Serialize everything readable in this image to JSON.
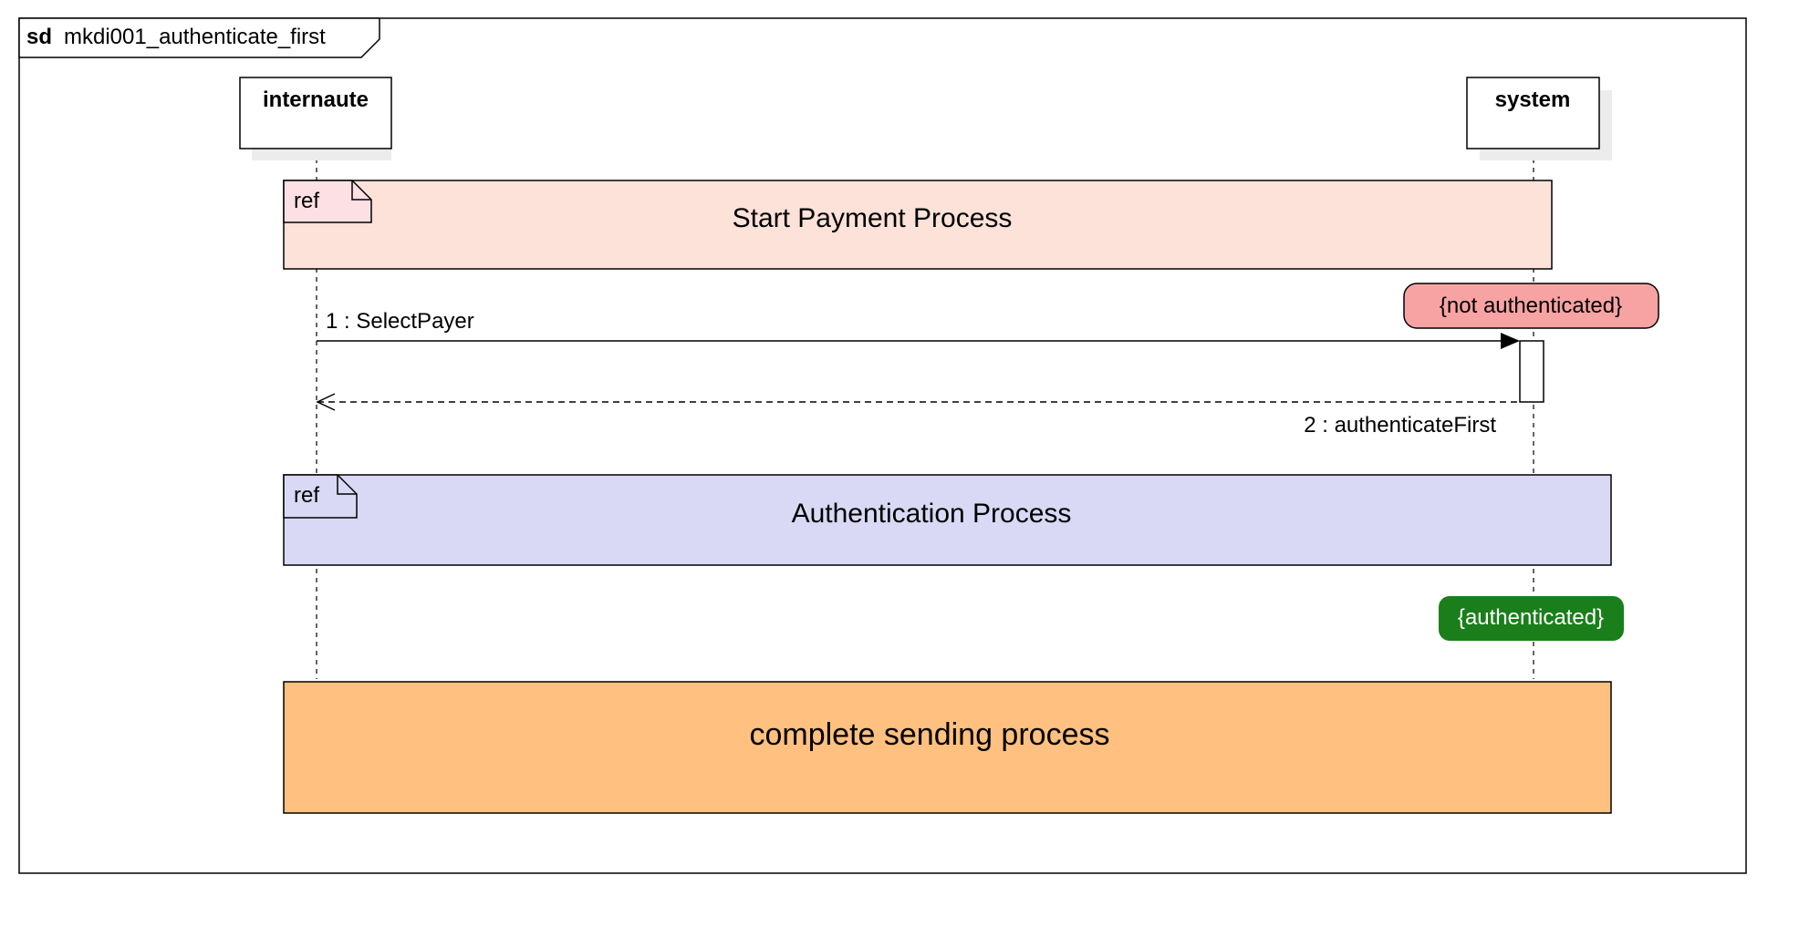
{
  "frame": {
    "keyword": "sd",
    "name": "mkdi001_authenticate_first"
  },
  "lifelines": {
    "left": {
      "label": "internaute"
    },
    "right": {
      "label": "system"
    }
  },
  "fragments": {
    "start_payment": {
      "tag": "ref",
      "label": "Start Payment Process",
      "fill": "#fde2d9"
    },
    "authentication": {
      "tag": "ref",
      "label": "Authentication Process",
      "fill": "#d9d9f5"
    },
    "complete_sending": {
      "label": "complete sending process",
      "fill": "#ffc080"
    }
  },
  "messages": {
    "select_payer": {
      "label": "1 : SelectPayer",
      "kind": "synchronous"
    },
    "authenticate_first": {
      "label": "2 : authenticateFirst",
      "kind": "reply"
    }
  },
  "states": {
    "not_authenticated": {
      "label": "{not authenticated}",
      "fill": "#f8a3a3"
    },
    "authenticated": {
      "label": "{authenticated}",
      "fill": "#1a7f1a"
    }
  }
}
